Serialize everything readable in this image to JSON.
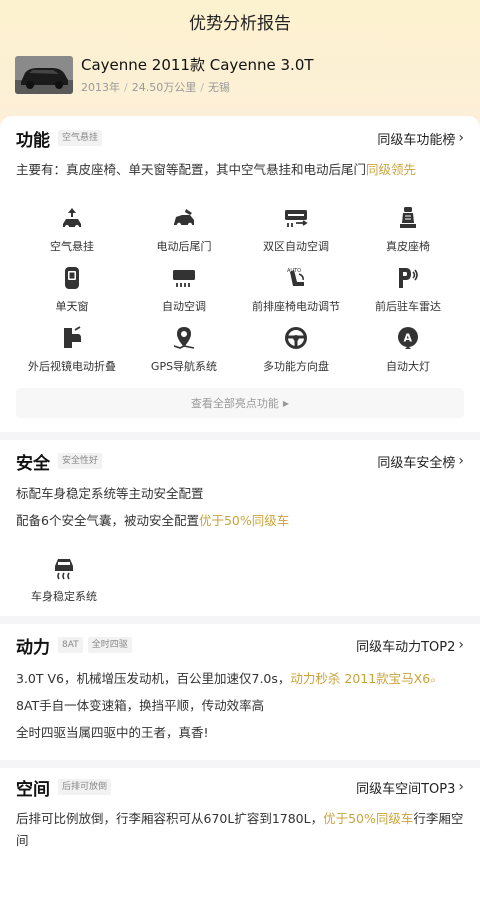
{
  "header": {
    "title": "优势分析报告"
  },
  "car": {
    "title": "Cayenne 2011款 Cayenne 3.0T",
    "year": "2013年",
    "mileage": "24.50万公里",
    "city": "无锡",
    "sep": "/"
  },
  "function": {
    "title": "功能",
    "tag": "空气悬挂",
    "rank": "同级车功能榜",
    "summary_prefix": "主要有：真皮座椅、单天窗等配置，其中空气悬挂和电动后尾门",
    "summary_highlight": "同级领先",
    "features": [
      {
        "label": "空气悬挂",
        "icon": "air-suspension-icon"
      },
      {
        "label": "电动后尾门",
        "icon": "power-tailgate-icon"
      },
      {
        "label": "双区自动空调",
        "icon": "dual-zone-ac-icon"
      },
      {
        "label": "真皮座椅",
        "icon": "leather-seat-icon"
      },
      {
        "label": "单天窗",
        "icon": "sunroof-icon"
      },
      {
        "label": "自动空调",
        "icon": "auto-ac-icon"
      },
      {
        "label": "前排座椅电动调节",
        "icon": "power-seat-icon"
      },
      {
        "label": "前后驻车雷达",
        "icon": "parking-radar-icon"
      },
      {
        "label": "外后视镜电动折叠",
        "icon": "mirror-fold-icon"
      },
      {
        "label": "GPS导航系统",
        "icon": "gps-icon"
      },
      {
        "label": "多功能方向盘",
        "icon": "steering-wheel-icon"
      },
      {
        "label": "自动大灯",
        "icon": "auto-headlight-icon"
      }
    ],
    "more_label": "查看全部亮点功能"
  },
  "safety": {
    "title": "安全",
    "tag": "安全性好",
    "rank": "同级车安全榜",
    "line1": "标配车身稳定系统等主动安全配置",
    "line2_prefix": "配备6个安全气囊，被动安全配置",
    "line2_highlight": "优于50%同级车",
    "feature_label": "车身稳定系统",
    "feature_icon": "stability-control-icon"
  },
  "power": {
    "title": "动力",
    "tags": [
      "8AT",
      "全时四驱"
    ],
    "rank": "同级车动力TOP2",
    "line1_prefix": "3.0T V6，机械增压发动机，百公里加速仅7.0s，",
    "line1_highlight": "动力秒杀 2011款宝马X6",
    "line2": "8AT手自一体变速箱，换挡平顺，传动效率高",
    "line3": "全时四驱当属四驱中的王者，真香!"
  },
  "space": {
    "title": "空间",
    "tag": "后排可放倒",
    "rank": "同级车空间TOP3",
    "text_prefix": "后排可比例放倒，行李厢容积可从670L扩容到1780L，",
    "text_highlight": "优于50%同级车",
    "text_suffix": "行李厢空间"
  },
  "colors": {
    "highlight": "#c9a43c",
    "accent_bg": "#fdf2cf"
  }
}
